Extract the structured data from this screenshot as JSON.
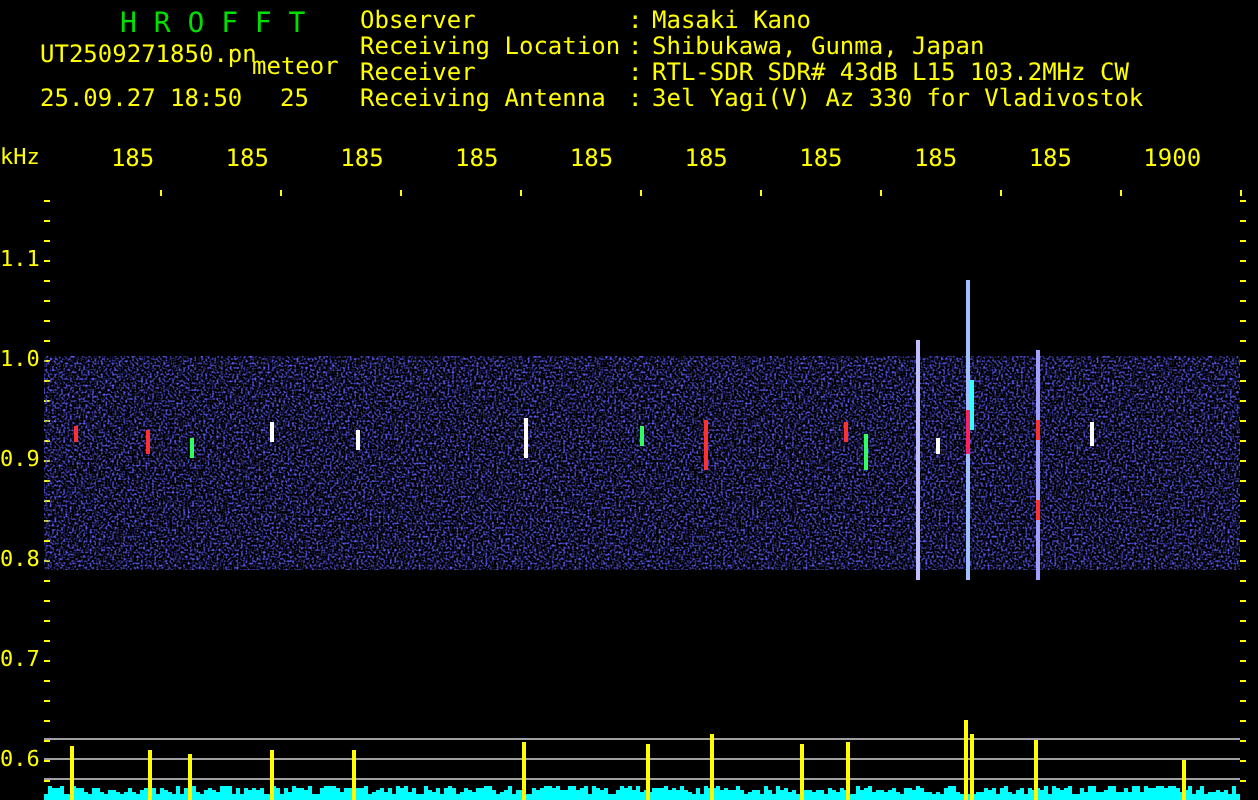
{
  "header": {
    "title": "H R O F F T",
    "file_name": "UT2509271850.pn",
    "mode": "meteor",
    "datetime": "25.09.27 18:50",
    "count": "25"
  },
  "station_info": [
    {
      "label": "Observer",
      "separator": ":",
      "value": "Masaki Kano"
    },
    {
      "label": "Receiving Location",
      "separator": ":",
      "value": "Shibukawa, Gunma, Japan"
    },
    {
      "label": "Receiver",
      "separator": ":",
      "value": "RTL-SDR SDR# 43dB L15 103.2MHz CW"
    },
    {
      "label": "Receiving Antenna",
      "separator": ":",
      "value": "3el Yagi(V) Az 330 for Vladivostok"
    }
  ],
  "frequency_unit": "kHz",
  "time_labels": [
    "185",
    "185",
    "185",
    "185",
    "185",
    "185",
    "185",
    "185",
    "185",
    "1900"
  ],
  "frequency_labels": [
    "1.1",
    "1.0",
    "0.9",
    "0.8",
    "0.7",
    "0.6"
  ]
}
